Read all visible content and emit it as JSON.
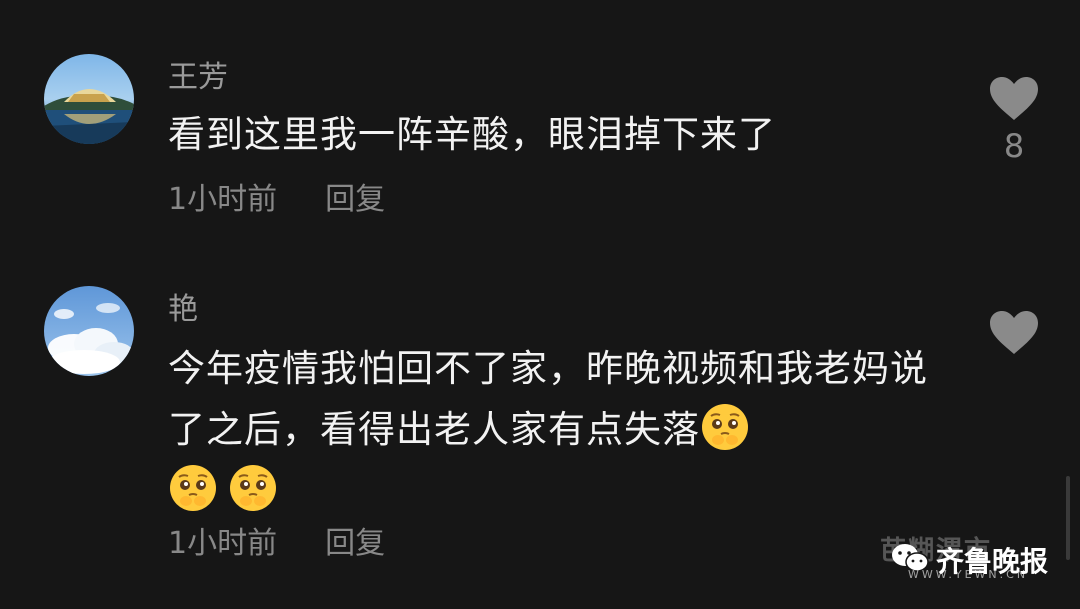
{
  "comments": [
    {
      "username": "王芳",
      "text": "看到这里我一阵辛酸，眼泪掉下来了",
      "time": "1小时前",
      "reply_label": "回复",
      "likes": "8",
      "avatar_icon": "landscape-photo-avatar"
    },
    {
      "username": "艳",
      "text": "今年疫情我怕回不了家，昨晚视频和我老妈说了之后，看得出老人家有点失落",
      "emojis": [
        "pleading-face",
        "pleading-face",
        "pleading-face"
      ],
      "time": "1小时前",
      "reply_label": "回复",
      "likes": "",
      "avatar_icon": "sky-clouds-avatar"
    }
  ],
  "watermark": {
    "faint_text": "芭糊渭市",
    "main_text": "齐鲁晚报",
    "site": "WWW.YEWN.CN"
  },
  "colors": {
    "background": "#161616",
    "text": "#f2f2f2",
    "secondary": "#888888",
    "heart": "#8a8a8a"
  }
}
